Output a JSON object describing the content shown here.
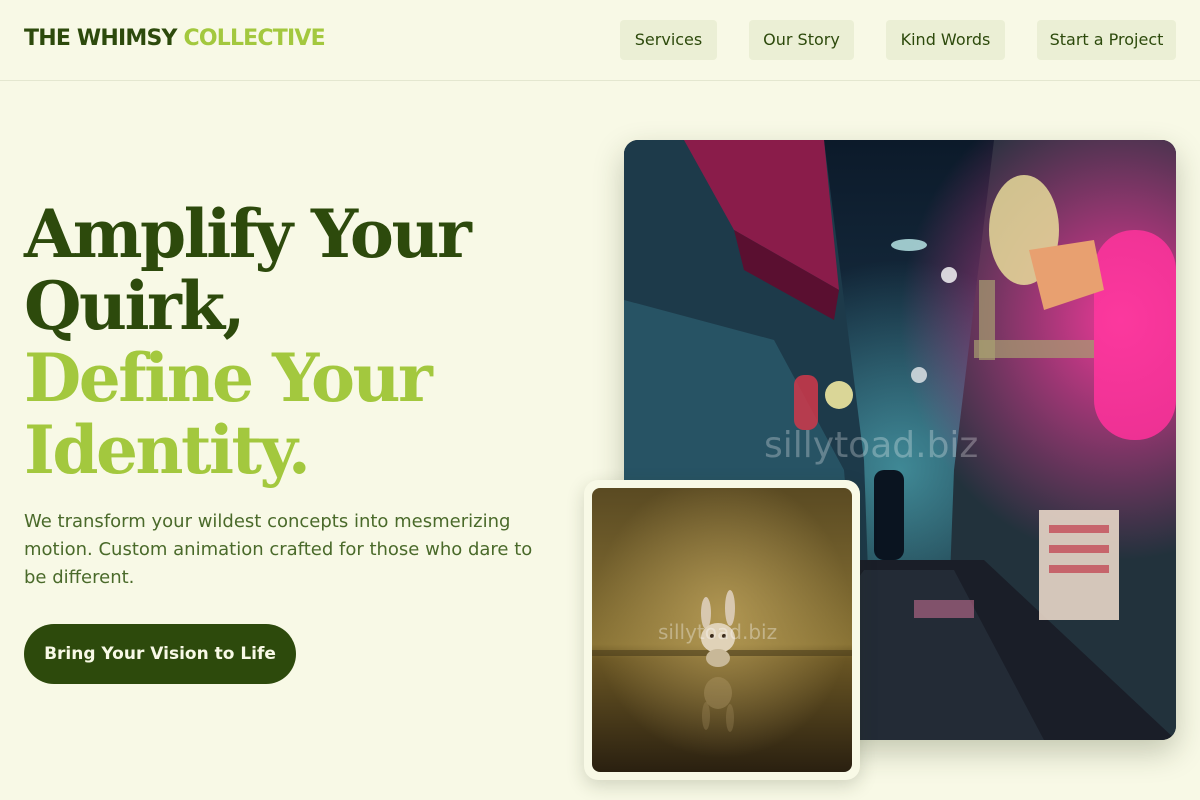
{
  "header": {
    "logo_dark": "THE WHIMSY",
    "logo_lime": "COLLECTIVE",
    "nav": [
      {
        "label": "Services"
      },
      {
        "label": "Our Story"
      },
      {
        "label": "Kind Words"
      },
      {
        "label": "Start a Project"
      }
    ]
  },
  "hero": {
    "headline_dark_1": "Amplify Your",
    "headline_dark_2": "Quirk,",
    "headline_lime_1": "Define Your",
    "headline_lime_2": "Identity.",
    "subtext": "We transform your wildest concepts into mesmerizing motion. Custom animation crafted for those who dare to be different.",
    "cta_label": "Bring Your Vision to Life"
  },
  "images": {
    "main_watermark": "sillytoad.biz",
    "small_watermark": "sillytoad.biz"
  },
  "colors": {
    "background": "#f8f9e6",
    "brand_dark": "#2d4a0c",
    "brand_lime": "#a3c83e",
    "nav_bg": "#ebefd5"
  }
}
